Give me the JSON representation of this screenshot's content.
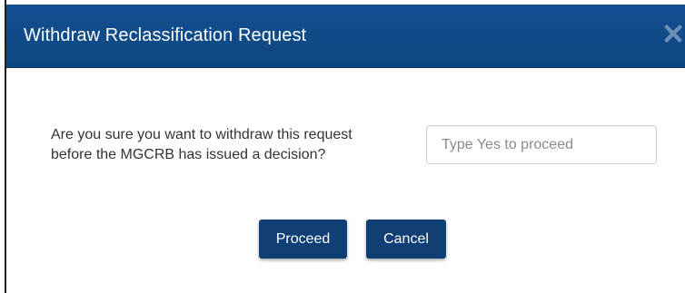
{
  "dialog": {
    "title": "Withdraw Reclassification Request",
    "close_icon": "close-x-icon",
    "message": "Are you sure you want to withdraw this request before the MGCRB has issued a decision?",
    "confirm_input": {
      "value": "",
      "placeholder": "Type Yes to proceed"
    },
    "buttons": {
      "proceed_label": "Proceed",
      "cancel_label": "Cancel"
    }
  },
  "colors": {
    "header": "#134f93",
    "button": "#0f3f74",
    "text": "#333333"
  }
}
